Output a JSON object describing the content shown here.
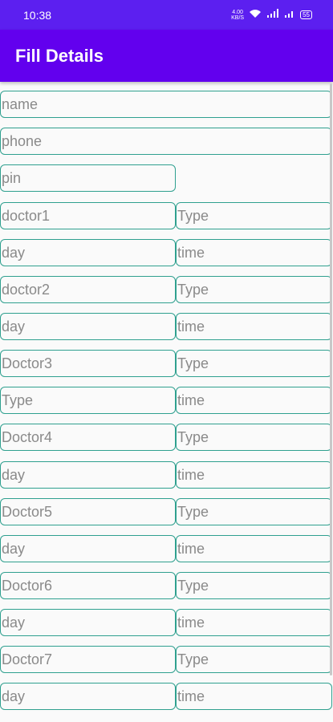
{
  "status": {
    "time": "10:38",
    "net_speed": "4.00\nKB/S",
    "battery": "55"
  },
  "appbar": {
    "title": "Fill Details"
  },
  "form": {
    "name": "name",
    "phone": "phone",
    "pin": "pin",
    "rows": [
      {
        "left": "doctor1",
        "right": "Type"
      },
      {
        "left": "day",
        "right": "time"
      },
      {
        "left": "doctor2",
        "right": "Type"
      },
      {
        "left": "day",
        "right": "time"
      },
      {
        "left": "Doctor3",
        "right": "Type"
      },
      {
        "left": "Type",
        "right": "time"
      },
      {
        "left": "Doctor4",
        "right": "Type"
      },
      {
        "left": "day",
        "right": "time"
      },
      {
        "left": "Doctor5",
        "right": "Type"
      },
      {
        "left": "day",
        "right": "time"
      },
      {
        "left": "Doctor6",
        "right": "Type"
      },
      {
        "left": "day",
        "right": "time"
      },
      {
        "left": "Doctor7",
        "right": "Type"
      },
      {
        "left": "day",
        "right": "time"
      }
    ]
  }
}
